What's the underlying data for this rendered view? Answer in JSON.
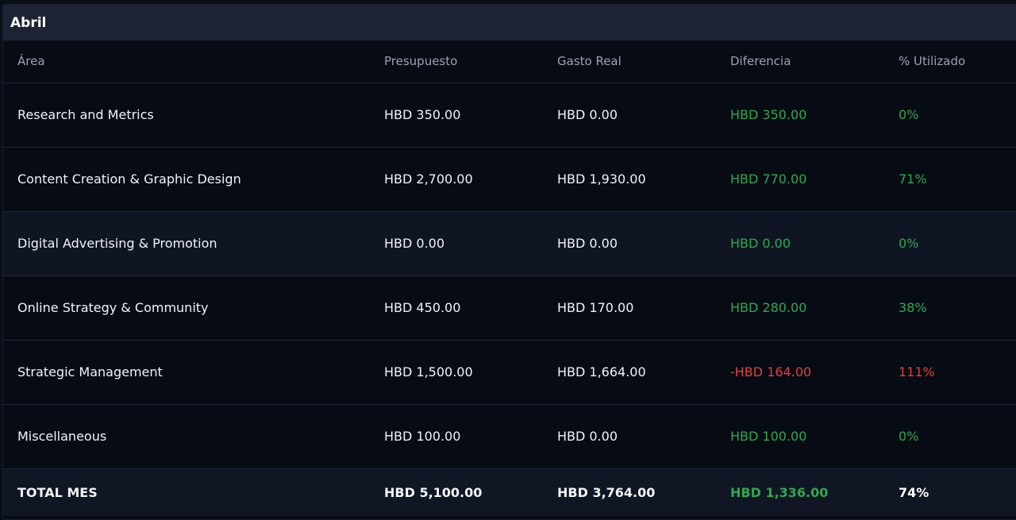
{
  "panel": {
    "title": "Abril"
  },
  "table": {
    "headers": [
      "Área",
      "Presupuesto",
      "Gasto Real",
      "Diferencia",
      "% Utilizado"
    ],
    "rows": [
      {
        "area": "Research and Metrics",
        "budget": "HBD 350.00",
        "spent": "HBD 0.00",
        "diff": "HBD 350.00",
        "pct": "0%",
        "status": "pos"
      },
      {
        "area": "Content Creation & Graphic Design",
        "budget": "HBD 2,700.00",
        "spent": "HBD 1,930.00",
        "diff": "HBD 770.00",
        "pct": "71%",
        "status": "pos"
      },
      {
        "area": "Digital Advertising & Promotion",
        "budget": "HBD 0.00",
        "spent": "HBD 0.00",
        "diff": "HBD 0.00",
        "pct": "0%",
        "status": "pos"
      },
      {
        "area": "Online Strategy & Community",
        "budget": "HBD 450.00",
        "spent": "HBD 170.00",
        "diff": "HBD 280.00",
        "pct": "38%",
        "status": "pos"
      },
      {
        "area": "Strategic Management",
        "budget": "HBD 1,500.00",
        "spent": "HBD 1,664.00",
        "diff": "-HBD 164.00",
        "pct": "111%",
        "status": "neg"
      },
      {
        "area": "Miscellaneous",
        "budget": "HBD 100.00",
        "spent": "HBD 0.00",
        "diff": "HBD 100.00",
        "pct": "0%",
        "status": "pos"
      }
    ],
    "total": {
      "area": "TOTAL MES",
      "budget": "HBD 5,100.00",
      "spent": "HBD 3,764.00",
      "diff": "HBD 1,336.00",
      "pct": "74%"
    }
  },
  "colors": {
    "positive": "#2fa84f",
    "negative": "#e0413a",
    "header_bg": "#1c2433",
    "panel_bg": "#070b14"
  }
}
